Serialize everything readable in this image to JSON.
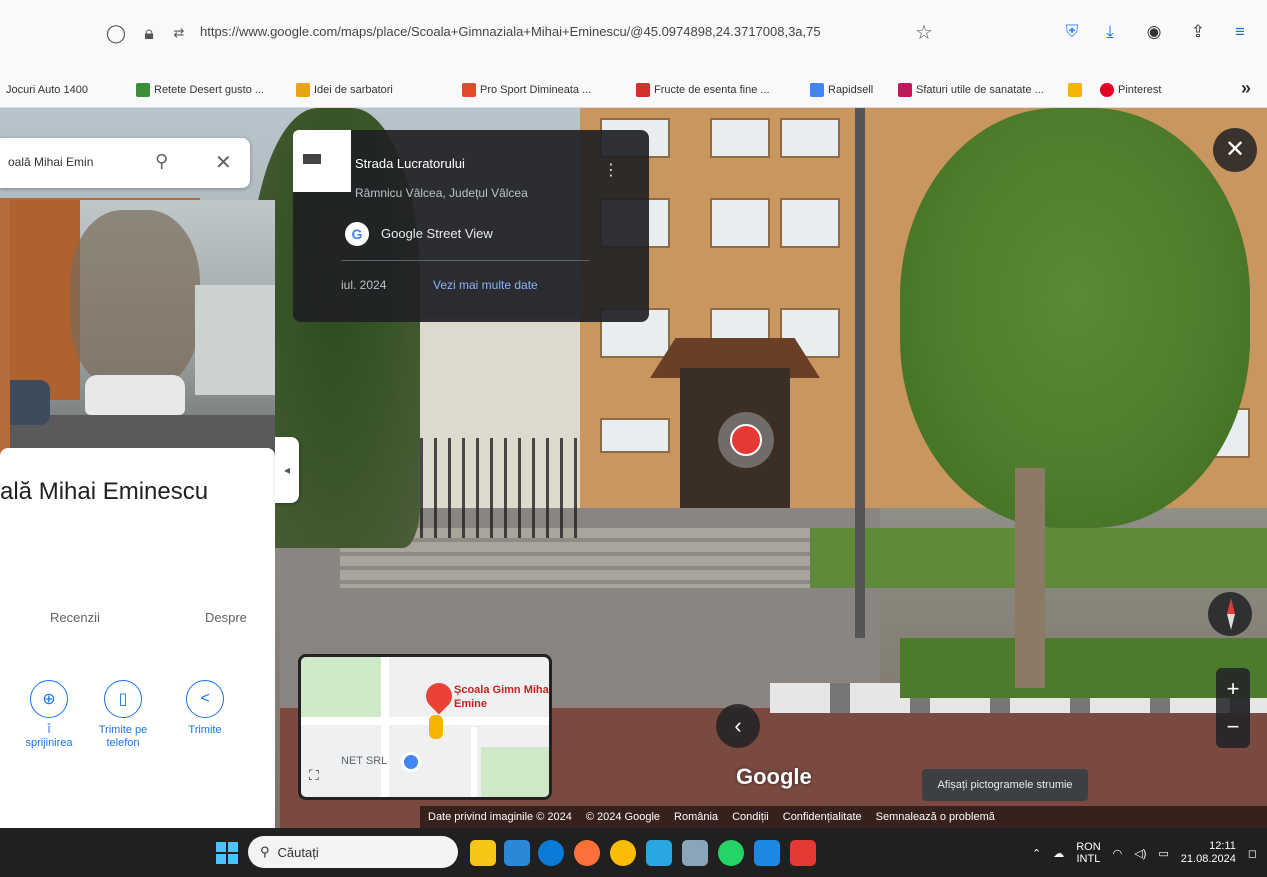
{
  "browser": {
    "url": "https://www.google.com/maps/place/Scoala+Gimnaziala+Mihai+Eminescu/@45.0974898,24.3717008,3a,75",
    "bookmarks": [
      {
        "label": "Jocuri Auto 1400",
        "color": "#888888"
      },
      {
        "label": "Retete Desert gusto ...",
        "color": "#3b8f3b"
      },
      {
        "label": "Idei de sarbatori",
        "color": "#e8a317"
      },
      {
        "label": "Pro Sport Dimineata ...",
        "color": "#e34a27"
      },
      {
        "label": "Fructe de esenta fine ...",
        "color": "#d32f2f"
      },
      {
        "label": "Rapidsell",
        "color": "#4285f4"
      },
      {
        "label": "Sfaturi utile de sanatate ...",
        "color": "#c2185b"
      },
      {
        "label": "",
        "color": "#f5b400"
      },
      {
        "label": "Pinterest",
        "color": "#e60023"
      }
    ],
    "more": "»"
  },
  "search": {
    "value": "oală Mihai Emin"
  },
  "info_card": {
    "title": "Strada Lucratorului",
    "subtitle": "Râmnicu Vâlcea, Județul Vâlcea",
    "provider": "Google Street View",
    "date": "iul. 2024",
    "more_link": "Vezi mai multe date"
  },
  "place": {
    "name": "ală Mihai Eminescu",
    "tabs": [
      "Recenzii",
      "Despre"
    ],
    "actions": [
      {
        "icon": "directions-icon",
        "glyph": "⊕",
        "label": "Î\nsprijinirea"
      },
      {
        "icon": "phone-icon",
        "glyph": "▯",
        "label": "Trimite pe\ntelefon"
      },
      {
        "icon": "share-icon",
        "glyph": "<",
        "label": "Trimite"
      }
    ]
  },
  "minimap": {
    "pin_label": "Școala Gimn Mihai Emine",
    "ref_label": "NET SRL"
  },
  "tooltip": "Afișați pictogramele strumie",
  "credits": [
    "Date privind imaginile © 2024",
    "© 2024 Google",
    "România",
    "Condiții",
    "Confidențialitate",
    "Semnalează o problemă"
  ],
  "watermark": "Google",
  "taskbar": {
    "search_placeholder": "Căutați",
    "lang_top": "RON",
    "lang_bottom": "INTL",
    "time": "12:11",
    "date": "21.08.2024"
  }
}
